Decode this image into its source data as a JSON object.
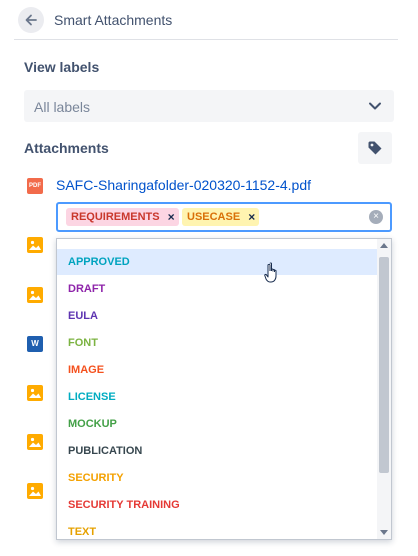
{
  "header": {
    "title": "Smart Attachments",
    "back_icon": "arrow-left-icon"
  },
  "view_labels": {
    "heading": "View labels",
    "select_value": "All labels"
  },
  "attachments": {
    "heading": "Attachments",
    "tag_button_icon": "tag-icon",
    "files": [
      {
        "type": "pdf",
        "name": "SAFC-Sharingafolder-020320-1152-4.pdf",
        "badge": "PDF"
      },
      {
        "type": "image",
        "name": ""
      },
      {
        "type": "image",
        "name": ""
      },
      {
        "type": "word",
        "name": "",
        "badge": "W"
      },
      {
        "type": "image",
        "name": ""
      },
      {
        "type": "image",
        "name": ""
      },
      {
        "type": "image",
        "name": ""
      }
    ]
  },
  "label_input": {
    "chips": [
      {
        "label": "REQUIREMENTS",
        "color": "#c9372c",
        "bg": "#fcd5e3"
      },
      {
        "label": "USECASE",
        "color": "#d97008",
        "bg": "#fff4b0"
      }
    ],
    "remove_glyph": "×",
    "clear_glyph": "×"
  },
  "dropdown": {
    "options": [
      {
        "label": "APPROVED",
        "color": "#00a3bf",
        "highlighted": true
      },
      {
        "label": "DRAFT",
        "color": "#8e24aa"
      },
      {
        "label": "EULA",
        "color": "#5e35b1"
      },
      {
        "label": "FONT",
        "color": "#7cb342"
      },
      {
        "label": "IMAGE",
        "color": "#f4511e"
      },
      {
        "label": "LICENSE",
        "color": "#00acc1"
      },
      {
        "label": "MOCKUP",
        "color": "#43a047"
      },
      {
        "label": "PUBLICATION",
        "color": "#37474f"
      },
      {
        "label": "SECURITY",
        "color": "#f4a100"
      },
      {
        "label": "SECURITY TRAINING",
        "color": "#e53935"
      },
      {
        "label": "TEXT",
        "color": "#e6a100"
      }
    ]
  },
  "colors": {
    "accent": "#0052cc",
    "focus_border": "#4c9aff",
    "highlight_bg": "#deebff"
  }
}
